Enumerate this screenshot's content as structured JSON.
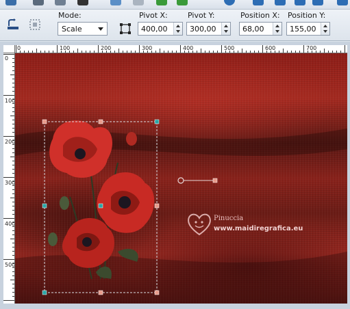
{
  "options_bar": {
    "mode_label": "Mode:",
    "mode_value": "Scale",
    "pivot_x_label": "Pivot X:",
    "pivot_x_value": "400,00",
    "pivot_y_label": "Pivot Y:",
    "pivot_y_value": "300,00",
    "position_x_label": "Position X:",
    "position_x_value": "68,00",
    "position_y_label": "Position Y:",
    "position_y_value": "155,00"
  },
  "ruler_h": {
    "labels": [
      "0",
      "100",
      "200",
      "300",
      "400",
      "500",
      "600",
      "700"
    ]
  },
  "ruler_v": {
    "labels": [
      "0",
      "100",
      "200",
      "300",
      "400",
      "500"
    ]
  },
  "watermark": {
    "name": "Pinuccia",
    "url": "www.maidiregrafica.eu"
  },
  "colors": {
    "accent_handle": "#e89a8a",
    "center_handle": "#2aa6a6"
  }
}
